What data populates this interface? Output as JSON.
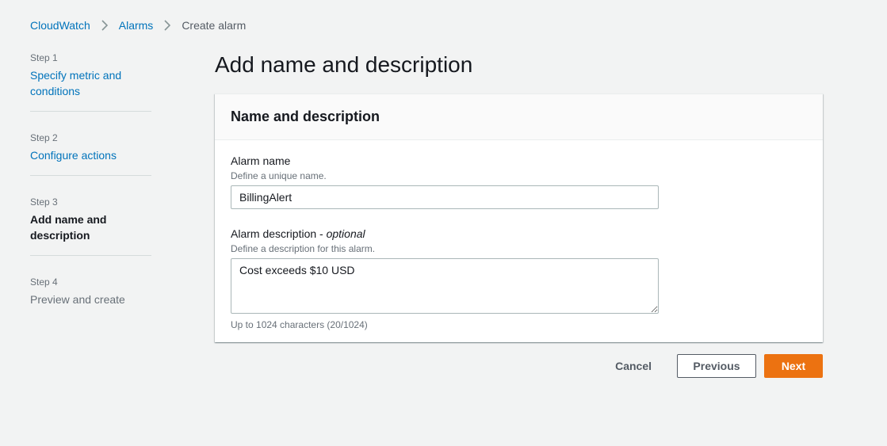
{
  "breadcrumb": {
    "items": [
      "CloudWatch",
      "Alarms"
    ],
    "current": "Create alarm",
    "separator_icon": "chevron-right-icon"
  },
  "steps": [
    {
      "number": "Step 1",
      "title": "Specify metric and conditions",
      "state": "link"
    },
    {
      "number": "Step 2",
      "title": "Configure actions",
      "state": "link"
    },
    {
      "number": "Step 3",
      "title": "Add name and description",
      "state": "current"
    },
    {
      "number": "Step 4",
      "title": "Preview and create",
      "state": "disabled"
    }
  ],
  "page": {
    "title": "Add name and description"
  },
  "panel": {
    "header": "Name and description",
    "alarm_name": {
      "label": "Alarm name",
      "description": "Define a unique name.",
      "value": "BillingAlert"
    },
    "alarm_description": {
      "label": "Alarm description - ",
      "label_optional": "optional",
      "description": "Define a description for this alarm.",
      "value": "Cost exceeds $10 USD",
      "constraint": "Up to 1024 characters (20/1024)"
    }
  },
  "actions": {
    "cancel": "Cancel",
    "previous": "Previous",
    "next": "Next"
  },
  "colors": {
    "link": "#0073bb",
    "primary": "#ec7211",
    "background": "#f2f3f3"
  }
}
